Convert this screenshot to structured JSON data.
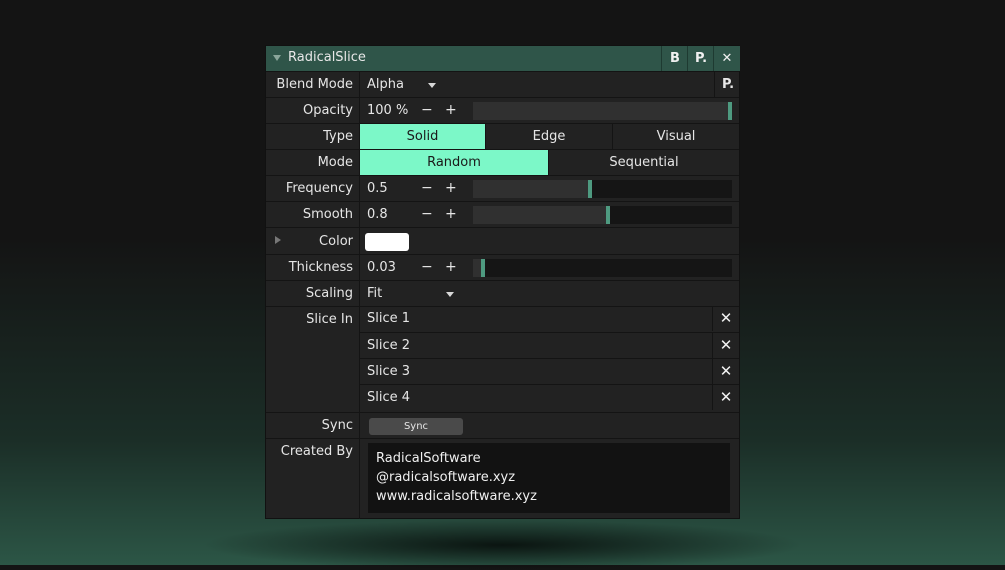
{
  "panel": {
    "title": "RadicalSlice",
    "header_buttons": [
      "B",
      "P.",
      "✕"
    ]
  },
  "blend_mode": {
    "label": "Blend Mode",
    "value": "Alpha",
    "preset_button": "P."
  },
  "opacity": {
    "label": "Opacity",
    "value": "100 %",
    "minus": "−",
    "plus": "+",
    "level": 1.0
  },
  "type": {
    "label": "Type",
    "options": [
      "Solid",
      "Edge",
      "Visual"
    ],
    "selected": "Solid"
  },
  "mode": {
    "label": "Mode",
    "options": [
      "Random",
      "Sequential"
    ],
    "selected": "Random"
  },
  "frequency": {
    "label": "Frequency",
    "value": "0.5",
    "minus": "−",
    "plus": "+",
    "level": 0.45
  },
  "smooth": {
    "label": "Smooth",
    "value": "0.8",
    "minus": "−",
    "plus": "+",
    "level": 0.52
  },
  "color": {
    "label": "Color",
    "swatch": "#ffffff"
  },
  "thickness": {
    "label": "Thickness",
    "value": "0.03",
    "minus": "−",
    "plus": "+",
    "level": 0.03
  },
  "scaling": {
    "label": "Scaling",
    "value": "Fit"
  },
  "slice_in": {
    "label": "Slice In",
    "items": [
      "Slice 1",
      "Slice 2",
      "Slice 3",
      "Slice 4"
    ],
    "remove": "✕"
  },
  "sync": {
    "label": "Sync",
    "button": "Sync"
  },
  "created_by": {
    "label": "Created By",
    "lines": [
      "RadicalSoftware",
      "@radicalsoftware.xyz",
      "www.radicalsoftware.xyz"
    ]
  },
  "colors": {
    "accent": "#7cf8c8",
    "header": "#2f5549",
    "handle": "#4e9a80"
  }
}
